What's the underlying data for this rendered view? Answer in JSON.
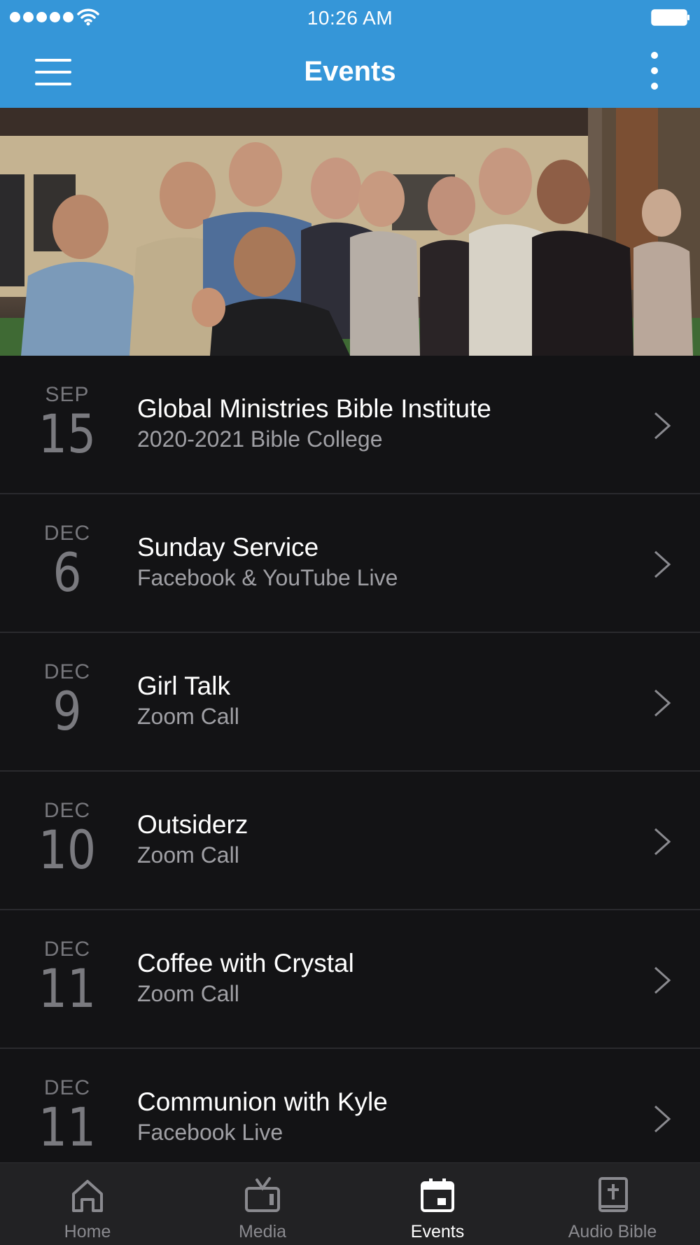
{
  "status_bar": {
    "time": "10:26 AM"
  },
  "header": {
    "title": "Events",
    "menu_icon": "hamburger-menu-icon",
    "more_icon": "vertical-ellipsis-icon"
  },
  "hero": {
    "description_icon": "group-photo"
  },
  "events": [
    {
      "month": "SEP",
      "day": "15",
      "title": "Global Ministries Bible Institute",
      "subtitle": "2020-2021 Bible College"
    },
    {
      "month": "DEC",
      "day": "6",
      "title": "Sunday Service",
      "subtitle": "Facebook & YouTube Live"
    },
    {
      "month": "DEC",
      "day": "9",
      "title": "Girl Talk",
      "subtitle": "Zoom Call"
    },
    {
      "month": "DEC",
      "day": "10",
      "title": "Outsiderz",
      "subtitle": "Zoom Call"
    },
    {
      "month": "DEC",
      "day": "11",
      "title": "Coffee with Crystal",
      "subtitle": "Zoom Call"
    },
    {
      "month": "DEC",
      "day": "11",
      "title": "Communion with Kyle",
      "subtitle": "Facebook Live"
    }
  ],
  "tabs": [
    {
      "label": "Home",
      "icon": "home-icon",
      "active": false
    },
    {
      "label": "Media",
      "icon": "tv-icon",
      "active": false
    },
    {
      "label": "Events",
      "icon": "calendar-icon",
      "active": true
    },
    {
      "label": "Audio Bible",
      "icon": "bible-icon",
      "active": false
    }
  ],
  "colors": {
    "accent": "#3596d8",
    "background": "#131315",
    "tabbar": "#222224"
  }
}
